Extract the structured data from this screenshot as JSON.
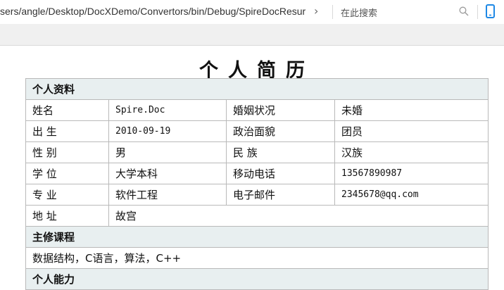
{
  "address_bar": {
    "path": "sers/angle/Desktop/DocXDemo/Convertors/bin/Debug/SpireDocResur",
    "search_placeholder": "在此搜索"
  },
  "document": {
    "title": "个人简历",
    "sections": {
      "personal_info": "个人资料",
      "courses": "主修课程",
      "abilities": "个人能力"
    },
    "fields": {
      "name_label": "姓名",
      "name_value": "Spire.Doc",
      "marital_label": "婚姻状况",
      "marital_value": "未婚",
      "birth_label": "出 生",
      "birth_value": "2010-09-19",
      "political_label": "政治面貌",
      "political_value": "团员",
      "gender_label": "性 别",
      "gender_value": "男",
      "ethnicity_label": "民 族",
      "ethnicity_value": "汉族",
      "degree_label": "学 位",
      "degree_value": "大学本科",
      "phone_label": "移动电话",
      "phone_value": "13567890987",
      "major_label": "专 业",
      "major_value": "软件工程",
      "email_label": "电子邮件",
      "email_value": "2345678@qq.com",
      "address_label": "地 址",
      "address_value": "故宫"
    },
    "courses_text": "数据结构，C语言，算法，C++"
  }
}
